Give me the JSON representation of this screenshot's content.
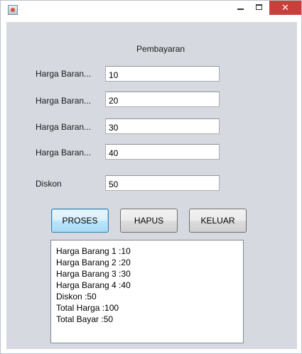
{
  "window": {
    "close_glyph": "✕"
  },
  "form": {
    "heading": "Pembayaran",
    "fields": [
      {
        "label": "Harga Baran...",
        "value": "10"
      },
      {
        "label": "Harga Baran...",
        "value": "20"
      },
      {
        "label": "Harga Baran...",
        "value": "30"
      },
      {
        "label": "Harga Baran...",
        "value": "40"
      },
      {
        "label": "Diskon",
        "value": "50"
      }
    ]
  },
  "buttons": {
    "proses": "PROSES",
    "hapus": "HAPUS",
    "keluar": "KELUAR"
  },
  "output": {
    "lines": [
      "Harga Barang 1 :10",
      "Harga Barang 2 :20",
      "Harga Barang 3 :30",
      "Harga Barang 4 :40",
      "Diskon :50",
      "Total Harga :100",
      "Total Bayar :50"
    ]
  },
  "colors": {
    "panel": "#d6d9df",
    "close_button": "#c7413b",
    "focus_border": "#3c7fb1"
  }
}
